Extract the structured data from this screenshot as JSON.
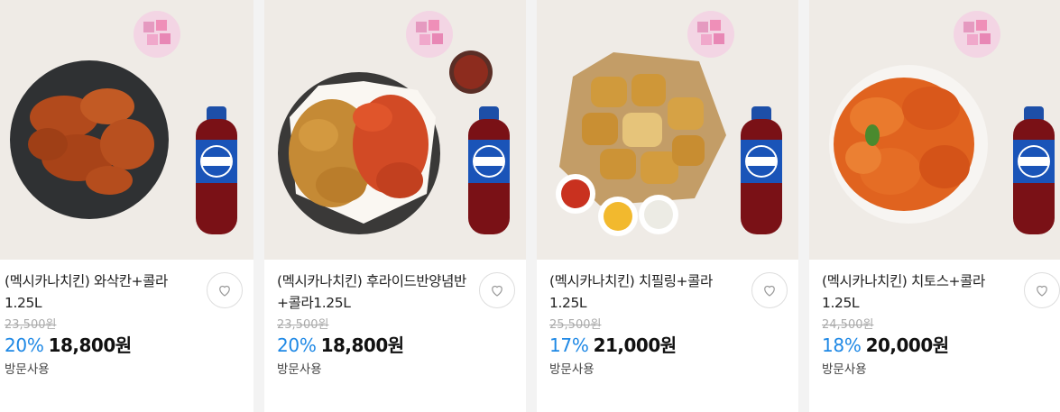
{
  "products": [
    {
      "title": "(멕시카나치킨) 와삭칸+콜라 1.25L",
      "original_price": "23,500원",
      "discount": "20%",
      "price": "18,800원",
      "usage": "방문사용",
      "image_alt": "fried chicken on dark plate with cola bottle",
      "wishlist_icon": "heart-outline-icon"
    },
    {
      "title": "(멕시카나치킨) 후라이드반양념반+콜라1.25L",
      "original_price": "23,500원",
      "discount": "20%",
      "price": "18,800원",
      "usage": "방문사용",
      "image_alt": "half fried half seasoned chicken with cola bottle",
      "wishlist_icon": "heart-outline-icon"
    },
    {
      "title": "(멕시카나치킨) 치필링+콜라 1.25L",
      "original_price": "25,500원",
      "discount": "17%",
      "price": "21,000원",
      "usage": "방문사용",
      "image_alt": "cheese filled chicken bites with dips and cola",
      "wishlist_icon": "heart-outline-icon"
    },
    {
      "title": "(멕시카나치킨) 치토스+콜라 1.25L",
      "original_price": "24,500원",
      "discount": "18%",
      "price": "20,000원",
      "usage": "방문사용",
      "image_alt": "cheetos coated chicken with cola bottle",
      "wishlist_icon": "heart-outline-icon"
    }
  ],
  "colors": {
    "discount": "#1e88e5",
    "price": "#111111",
    "original_price": "#aaaaaa"
  }
}
